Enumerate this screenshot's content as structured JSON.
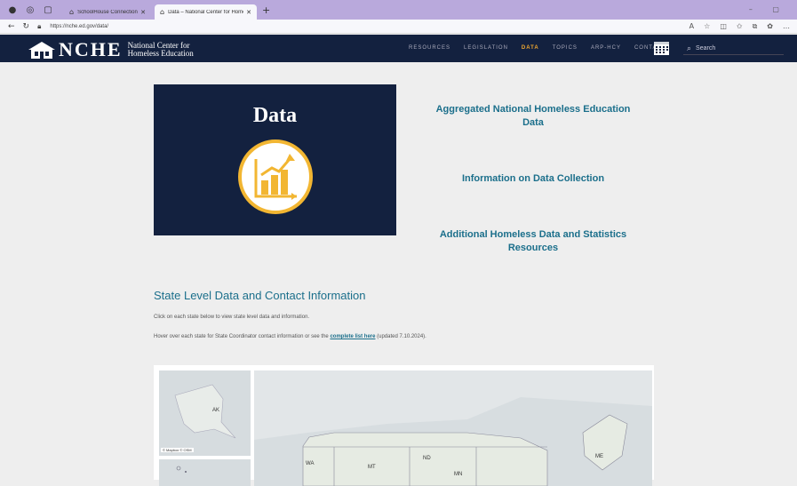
{
  "browser": {
    "tabs": [
      {
        "title": "SchoolHouse Connection",
        "active": false
      },
      {
        "title": "Data – National Center for Home",
        "active": true
      }
    ],
    "url": "https://nche.ed.gov/data/"
  },
  "site": {
    "logo_letters": "NCHE",
    "logo_sub_line1": "National Center for",
    "logo_sub_line2": "Homeless Education",
    "nav": [
      "RESOURCES",
      "LEGISLATION",
      "DATA",
      "TOPICS",
      "ARP-HCY",
      "CONTACT"
    ],
    "active_nav": "DATA",
    "search_placeholder": "Search"
  },
  "hero": {
    "title": "Data"
  },
  "links": [
    {
      "line1": "Aggregated National Homeless Education",
      "line2": "Data"
    },
    {
      "line1": "Information on Data Collection",
      "line2": ""
    },
    {
      "line1": "Additional Homeless Data and Statistics",
      "line2": "Resources"
    }
  ],
  "state_section": {
    "title": "State Level Data and Contact Information",
    "p1": "Click on each state below to view state level data and information.",
    "p2_before": "Hover over each state for State Coordinator contact information or see the ",
    "p2_link": "complete list here",
    "p2_after": " (updated 7.10.2024)."
  },
  "map": {
    "ak_label": "AK",
    "attribution": "© Mapbox © OSM",
    "state_labels": [
      "WA",
      "MT",
      "ND",
      "MN",
      "ME"
    ]
  },
  "colors": {
    "navy": "#13213f",
    "accent": "#f0a830",
    "link": "#1b6f8b",
    "tabbar": "#b9a9dc"
  }
}
